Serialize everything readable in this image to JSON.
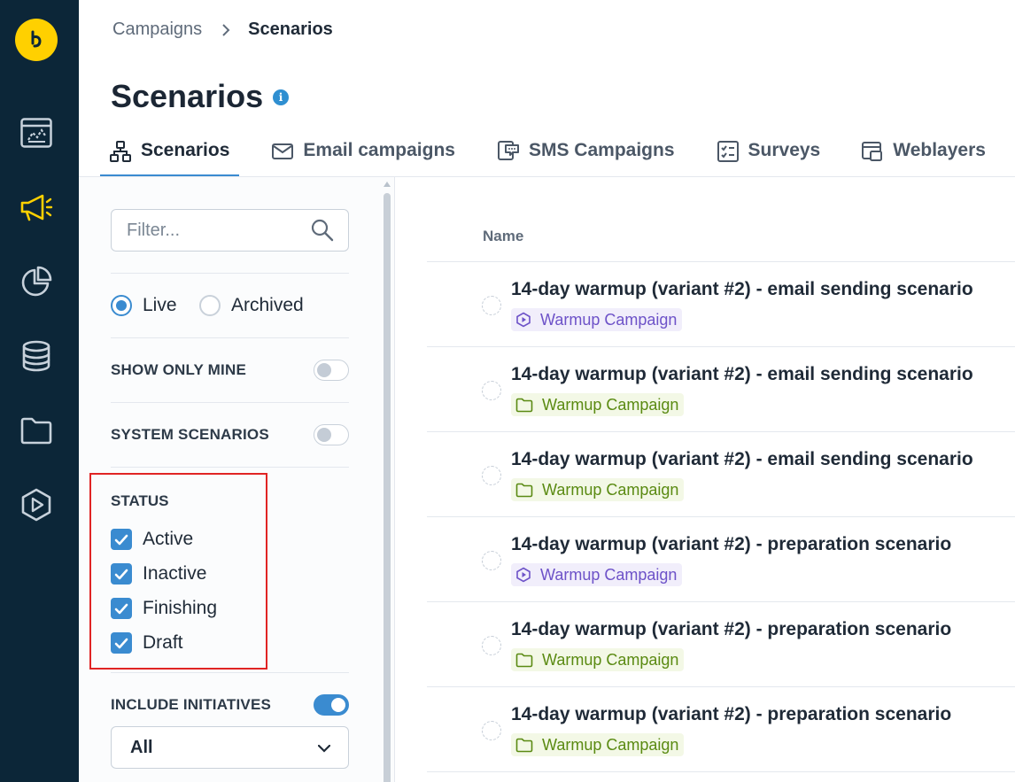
{
  "rail": {
    "logo": "bloomreach-logo",
    "items": [
      {
        "name": "dashboard-icon",
        "active": false
      },
      {
        "name": "megaphone-icon",
        "active": true
      },
      {
        "name": "pie-chart-icon",
        "active": false
      },
      {
        "name": "database-icon",
        "active": false
      },
      {
        "name": "folder-icon",
        "active": false
      },
      {
        "name": "play-hexagon-icon",
        "active": false
      }
    ],
    "colors": {
      "background": "#0c2638",
      "active": "#ffd000",
      "inactive": "#c7d1db"
    }
  },
  "breadcrumb": {
    "parent": "Campaigns",
    "current": "Scenarios"
  },
  "page": {
    "title": "Scenarios",
    "info_icon": "i"
  },
  "tabs": [
    {
      "label": "Scenarios",
      "icon": "scenario-tree-icon",
      "active": true
    },
    {
      "label": "Email campaigns",
      "icon": "envelope-icon",
      "active": false
    },
    {
      "label": "SMS Campaigns",
      "icon": "sms-icon",
      "active": false
    },
    {
      "label": "Surveys",
      "icon": "checklist-icon",
      "active": false
    },
    {
      "label": "Weblayers",
      "icon": "weblayer-icon",
      "active": false
    }
  ],
  "filters": {
    "search_placeholder": "Filter...",
    "search_value": "",
    "scope": {
      "live_label": "Live",
      "archived_label": "Archived",
      "selected": "Live"
    },
    "show_only_mine": {
      "label": "SHOW ONLY MINE",
      "on": false
    },
    "system_scenarios": {
      "label": "SYSTEM SCENARIOS",
      "on": false
    },
    "status": {
      "title": "STATUS",
      "options": [
        {
          "label": "Active",
          "checked": true
        },
        {
          "label": "Inactive",
          "checked": true
        },
        {
          "label": "Finishing",
          "checked": true
        },
        {
          "label": "Draft",
          "checked": true
        }
      ]
    },
    "include_initiatives": {
      "label": "INCLUDE INITIATIVES",
      "on": true
    },
    "initiative_select": {
      "value": "All"
    }
  },
  "list": {
    "column_name": "Name",
    "rows": [
      {
        "title": "14-day warmup (variant #2) - email sending scenario",
        "tag": "Warmup Campaign",
        "tag_type": "purple"
      },
      {
        "title": "14-day warmup (variant #2) - email sending scenario",
        "tag": "Warmup Campaign",
        "tag_type": "green"
      },
      {
        "title": "14-day warmup (variant #2) - email sending scenario",
        "tag": "Warmup Campaign",
        "tag_type": "green"
      },
      {
        "title": "14-day warmup (variant #2) - preparation scenario",
        "tag": "Warmup Campaign",
        "tag_type": "purple"
      },
      {
        "title": "14-day warmup (variant #2) - preparation scenario",
        "tag": "Warmup Campaign",
        "tag_type": "green"
      },
      {
        "title": "14-day warmup (variant #2) - preparation scenario",
        "tag": "Warmup Campaign",
        "tag_type": "green"
      }
    ]
  },
  "colors": {
    "accent": "#3a8bd0",
    "highlight_box": "#e02424"
  }
}
